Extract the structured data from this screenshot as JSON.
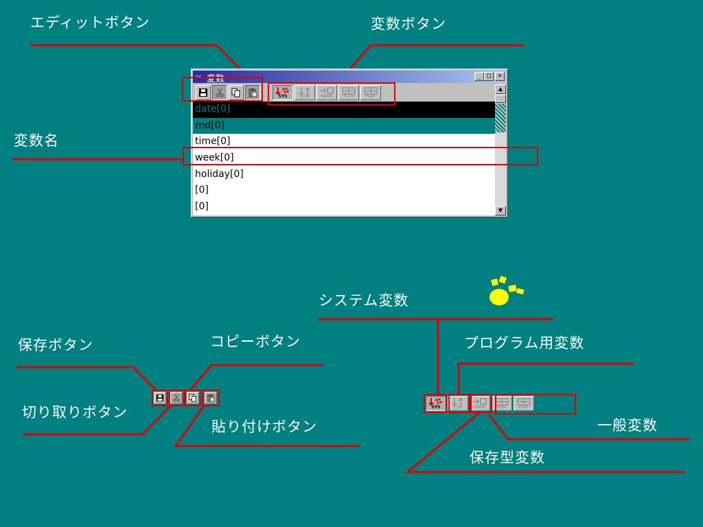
{
  "annotations": {
    "edit_buttons": "エディットボタン",
    "variable_buttons": "変数ボタン",
    "variable_name": "変数名",
    "system_variable": "システム変数",
    "save_button": "保存ボタン",
    "copy_button": "コピーボタン",
    "program_variable": "プログラム用変数",
    "cut_button": "切り取りボタン",
    "paste_button": "貼り付けボタン",
    "general_variable": "一般変数",
    "persistent_variable": "保存型変数"
  },
  "window": {
    "title": "変数",
    "minimize": "_",
    "maximize": "□",
    "close": "×"
  },
  "variable_buttons": [
    {
      "caption": "SYS",
      "icon": "down-arrow-dots-icon",
      "selected": true
    },
    {
      "caption": "COM",
      "icon": "up-down-arrow-icon",
      "selected": false
    },
    {
      "caption": "GAME",
      "icon": "arrow-to-disk-icon",
      "selected": false
    },
    {
      "caption": "PLAY",
      "icon": "grid-icon",
      "selected": false
    },
    {
      "caption": "PLAY",
      "icon": "grid-icon",
      "selected": false
    }
  ],
  "variables": [
    "date[0]",
    "rnd[0]",
    "time[0]",
    "week[0]",
    "holiday[0]",
    "[0]",
    "[0]"
  ],
  "colors": {
    "background": "#008080",
    "highlight_box": "#e00000",
    "decoration": "#ffff00"
  }
}
